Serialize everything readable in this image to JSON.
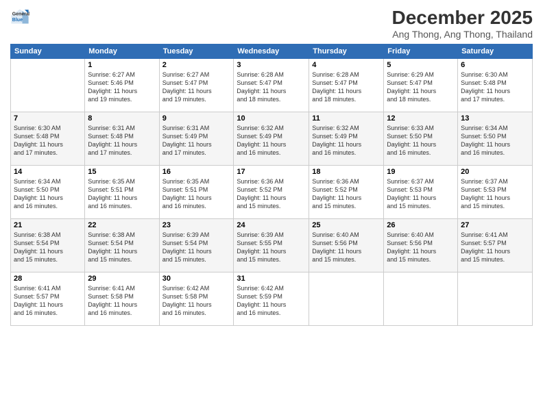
{
  "logo": {
    "line1": "General",
    "line2": "Blue"
  },
  "title": "December 2025",
  "location": "Ang Thong, Ang Thong, Thailand",
  "weekdays": [
    "Sunday",
    "Monday",
    "Tuesday",
    "Wednesday",
    "Thursday",
    "Friday",
    "Saturday"
  ],
  "weeks": [
    [
      {
        "day": "",
        "info": ""
      },
      {
        "day": "1",
        "info": "Sunrise: 6:27 AM\nSunset: 5:46 PM\nDaylight: 11 hours\nand 19 minutes."
      },
      {
        "day": "2",
        "info": "Sunrise: 6:27 AM\nSunset: 5:47 PM\nDaylight: 11 hours\nand 19 minutes."
      },
      {
        "day": "3",
        "info": "Sunrise: 6:28 AM\nSunset: 5:47 PM\nDaylight: 11 hours\nand 18 minutes."
      },
      {
        "day": "4",
        "info": "Sunrise: 6:28 AM\nSunset: 5:47 PM\nDaylight: 11 hours\nand 18 minutes."
      },
      {
        "day": "5",
        "info": "Sunrise: 6:29 AM\nSunset: 5:47 PM\nDaylight: 11 hours\nand 18 minutes."
      },
      {
        "day": "6",
        "info": "Sunrise: 6:30 AM\nSunset: 5:48 PM\nDaylight: 11 hours\nand 17 minutes."
      }
    ],
    [
      {
        "day": "7",
        "info": "Sunrise: 6:30 AM\nSunset: 5:48 PM\nDaylight: 11 hours\nand 17 minutes."
      },
      {
        "day": "8",
        "info": "Sunrise: 6:31 AM\nSunset: 5:48 PM\nDaylight: 11 hours\nand 17 minutes."
      },
      {
        "day": "9",
        "info": "Sunrise: 6:31 AM\nSunset: 5:49 PM\nDaylight: 11 hours\nand 17 minutes."
      },
      {
        "day": "10",
        "info": "Sunrise: 6:32 AM\nSunset: 5:49 PM\nDaylight: 11 hours\nand 16 minutes."
      },
      {
        "day": "11",
        "info": "Sunrise: 6:32 AM\nSunset: 5:49 PM\nDaylight: 11 hours\nand 16 minutes."
      },
      {
        "day": "12",
        "info": "Sunrise: 6:33 AM\nSunset: 5:50 PM\nDaylight: 11 hours\nand 16 minutes."
      },
      {
        "day": "13",
        "info": "Sunrise: 6:34 AM\nSunset: 5:50 PM\nDaylight: 11 hours\nand 16 minutes."
      }
    ],
    [
      {
        "day": "14",
        "info": "Sunrise: 6:34 AM\nSunset: 5:50 PM\nDaylight: 11 hours\nand 16 minutes."
      },
      {
        "day": "15",
        "info": "Sunrise: 6:35 AM\nSunset: 5:51 PM\nDaylight: 11 hours\nand 16 minutes."
      },
      {
        "day": "16",
        "info": "Sunrise: 6:35 AM\nSunset: 5:51 PM\nDaylight: 11 hours\nand 16 minutes."
      },
      {
        "day": "17",
        "info": "Sunrise: 6:36 AM\nSunset: 5:52 PM\nDaylight: 11 hours\nand 15 minutes."
      },
      {
        "day": "18",
        "info": "Sunrise: 6:36 AM\nSunset: 5:52 PM\nDaylight: 11 hours\nand 15 minutes."
      },
      {
        "day": "19",
        "info": "Sunrise: 6:37 AM\nSunset: 5:53 PM\nDaylight: 11 hours\nand 15 minutes."
      },
      {
        "day": "20",
        "info": "Sunrise: 6:37 AM\nSunset: 5:53 PM\nDaylight: 11 hours\nand 15 minutes."
      }
    ],
    [
      {
        "day": "21",
        "info": "Sunrise: 6:38 AM\nSunset: 5:54 PM\nDaylight: 11 hours\nand 15 minutes."
      },
      {
        "day": "22",
        "info": "Sunrise: 6:38 AM\nSunset: 5:54 PM\nDaylight: 11 hours\nand 15 minutes."
      },
      {
        "day": "23",
        "info": "Sunrise: 6:39 AM\nSunset: 5:54 PM\nDaylight: 11 hours\nand 15 minutes."
      },
      {
        "day": "24",
        "info": "Sunrise: 6:39 AM\nSunset: 5:55 PM\nDaylight: 11 hours\nand 15 minutes."
      },
      {
        "day": "25",
        "info": "Sunrise: 6:40 AM\nSunset: 5:56 PM\nDaylight: 11 hours\nand 15 minutes."
      },
      {
        "day": "26",
        "info": "Sunrise: 6:40 AM\nSunset: 5:56 PM\nDaylight: 11 hours\nand 15 minutes."
      },
      {
        "day": "27",
        "info": "Sunrise: 6:41 AM\nSunset: 5:57 PM\nDaylight: 11 hours\nand 15 minutes."
      }
    ],
    [
      {
        "day": "28",
        "info": "Sunrise: 6:41 AM\nSunset: 5:57 PM\nDaylight: 11 hours\nand 16 minutes."
      },
      {
        "day": "29",
        "info": "Sunrise: 6:41 AM\nSunset: 5:58 PM\nDaylight: 11 hours\nand 16 minutes."
      },
      {
        "day": "30",
        "info": "Sunrise: 6:42 AM\nSunset: 5:58 PM\nDaylight: 11 hours\nand 16 minutes."
      },
      {
        "day": "31",
        "info": "Sunrise: 6:42 AM\nSunset: 5:59 PM\nDaylight: 11 hours\nand 16 minutes."
      },
      {
        "day": "",
        "info": ""
      },
      {
        "day": "",
        "info": ""
      },
      {
        "day": "",
        "info": ""
      }
    ]
  ]
}
